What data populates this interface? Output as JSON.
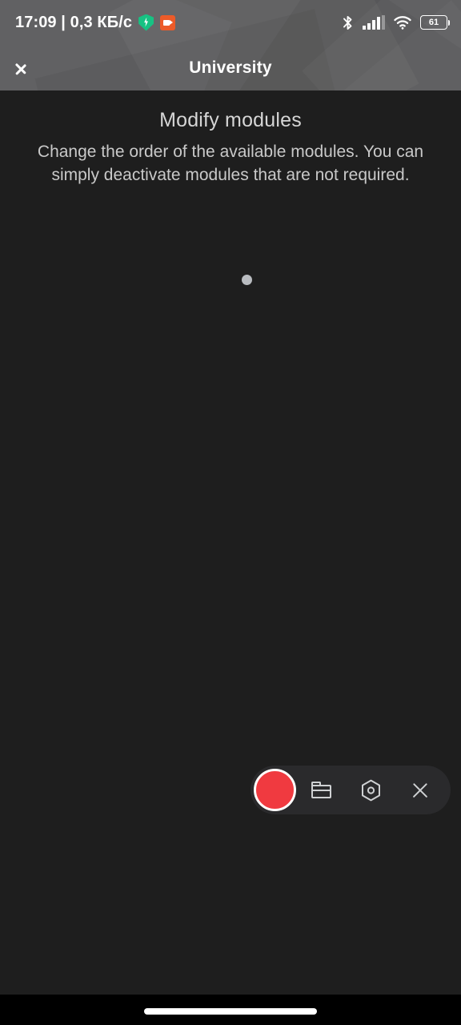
{
  "status_bar": {
    "clock": "17:09 | 0,3 КБ/с",
    "battery_level": "61",
    "icons": {
      "vpn_shield": "shield-bolt-icon",
      "screen_recorder": "screen-record-icon",
      "bluetooth": "bluetooth-icon",
      "signal": "cellular-signal-icon",
      "wifi": "wifi-icon",
      "battery": "battery-icon"
    },
    "colors": {
      "shield_green": "#17c283",
      "recorder_orange": "#ec5b29",
      "text": "#ffffff"
    }
  },
  "app_bar": {
    "back_label": "chevron-left-icon",
    "title": "University",
    "background": "#5c5c5e"
  },
  "main": {
    "title": "Modify modules",
    "description": "Change the order of the available modules. You can simply deactivate modules that are not required.",
    "loading_indicator": "loading-dot",
    "background": "#1e1e1e",
    "title_color": "#d6d6d6",
    "description_color": "#c9c9c9"
  },
  "recorder_toolbar": {
    "record_label": "record-button",
    "folder_label": "folder-button",
    "settings_label": "settings-button",
    "close_label": "close-button",
    "record_color": "#f03a40",
    "background": "#2a2a2c",
    "icon_color": "#cfd1d3"
  },
  "nav_bar": {
    "gesture_pill": "home-gesture-pill",
    "background": "#000000"
  }
}
